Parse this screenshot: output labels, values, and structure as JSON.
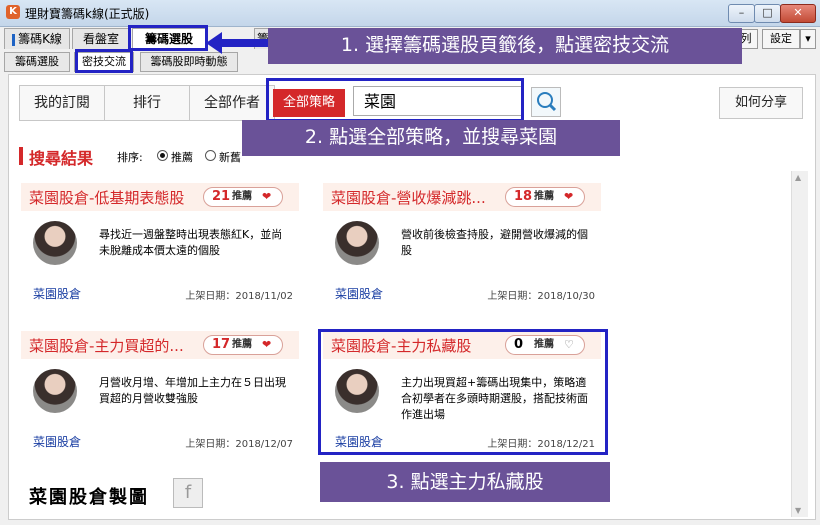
{
  "window": {
    "title": "理財寶籌碼k線(正式版)",
    "icon_label": "K",
    "minimize": "–",
    "maximize": "□",
    "close": "✕"
  },
  "main_tabs": [
    {
      "label": "籌碼K線"
    },
    {
      "label": "看盤室"
    },
    {
      "label": "籌碼選股"
    },
    {
      "label": "籌碼研"
    }
  ],
  "right_buttons": {
    "partial": "列",
    "settings": "設定",
    "dropdown": "▾"
  },
  "sub_tabs": [
    {
      "label": "籌碼選股"
    },
    {
      "label": "密技交流"
    },
    {
      "label": "籌碼股即時動態"
    }
  ],
  "toolbar": {
    "segments": [
      "我的訂閱",
      "排行",
      "全部作者"
    ],
    "strategy_button": "全部策略",
    "search_value": "菜園",
    "share_button": "如何分享"
  },
  "results": {
    "title": "搜尋結果",
    "sort_label": "排序:",
    "sort_options": [
      "推薦",
      "新舊"
    ]
  },
  "cards": [
    {
      "title": "菜園股倉-低基期表態股",
      "count": "21",
      "unit": "推薦",
      "liked": true,
      "heart": "❤",
      "desc": "尋找近一週盤整時出現表態紅K，並尚未脫離成本價太遠的個股",
      "author": "菜園股倉",
      "date": "上架日期：2018/11/02"
    },
    {
      "title": "菜園股倉-營收爆減跳...",
      "count": "18",
      "unit": "推薦",
      "liked": true,
      "heart": "❤",
      "desc": "營收前後檢查持股，避開營收爆減的個股",
      "author": "菜園股倉",
      "date": "上架日期：2018/10/30"
    },
    {
      "title": "菜園股倉-主力買超的...",
      "count": "17",
      "unit": "推薦",
      "liked": true,
      "heart": "❤",
      "desc": "月營收月增、年增加上主力在５日出現買超的月營收雙強股",
      "author": "菜園股倉",
      "date": "上架日期：2018/12/07"
    },
    {
      "title": "菜園股倉-主力私藏股",
      "count": "0",
      "unit": "推薦",
      "liked": false,
      "heart": "♡",
      "desc": "主力出現買超+籌碼出現集中，策略適合初學者在多頭時期選股，搭配技術面作進出場",
      "author": "菜園股倉",
      "date": "上架日期：2018/12/21"
    }
  ],
  "footer": {
    "title": "菜園股倉製圖",
    "fb_icon": "f"
  },
  "callouts": {
    "step1": "1. 選擇籌碼選股頁籤後，點選密技交流",
    "step2": "2. 點選全部策略，並搜尋菜園",
    "step3": "3. 點選主力私藏股"
  },
  "colors": {
    "accent_red": "#d4282a",
    "callout_purple": "#6a5298",
    "highlight_blue": "#2323c4",
    "author_blue": "#1b3fa3"
  }
}
